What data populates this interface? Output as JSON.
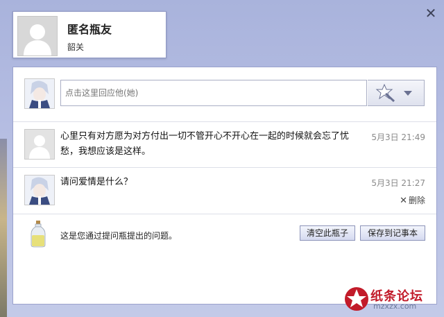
{
  "dialog": {
    "close_label": "✕"
  },
  "profile": {
    "name": "匿名瓶友",
    "location": "韶关"
  },
  "reply": {
    "placeholder": "点击这里回应他(她)"
  },
  "messages": [
    {
      "text": "心里只有对方愿为对方付出一切不管开心不开心在一起的时候就会忘了忧愁，我想应该是这样。",
      "time": "5月3日 21:49"
    },
    {
      "text": "请问爱情是什么？",
      "time": "5月3日 21:27",
      "delete_label": "删除"
    }
  ],
  "footer": {
    "note": "这是您通过提问瓶提出的问题。",
    "clear_button": "清空此瓶子",
    "save_button": "保存到记事本"
  },
  "watermark": {
    "text": "纸条论坛",
    "sub": "mzxzx.com"
  },
  "colors": {
    "accent": "#8e97c4",
    "background": "#b5bde2"
  }
}
